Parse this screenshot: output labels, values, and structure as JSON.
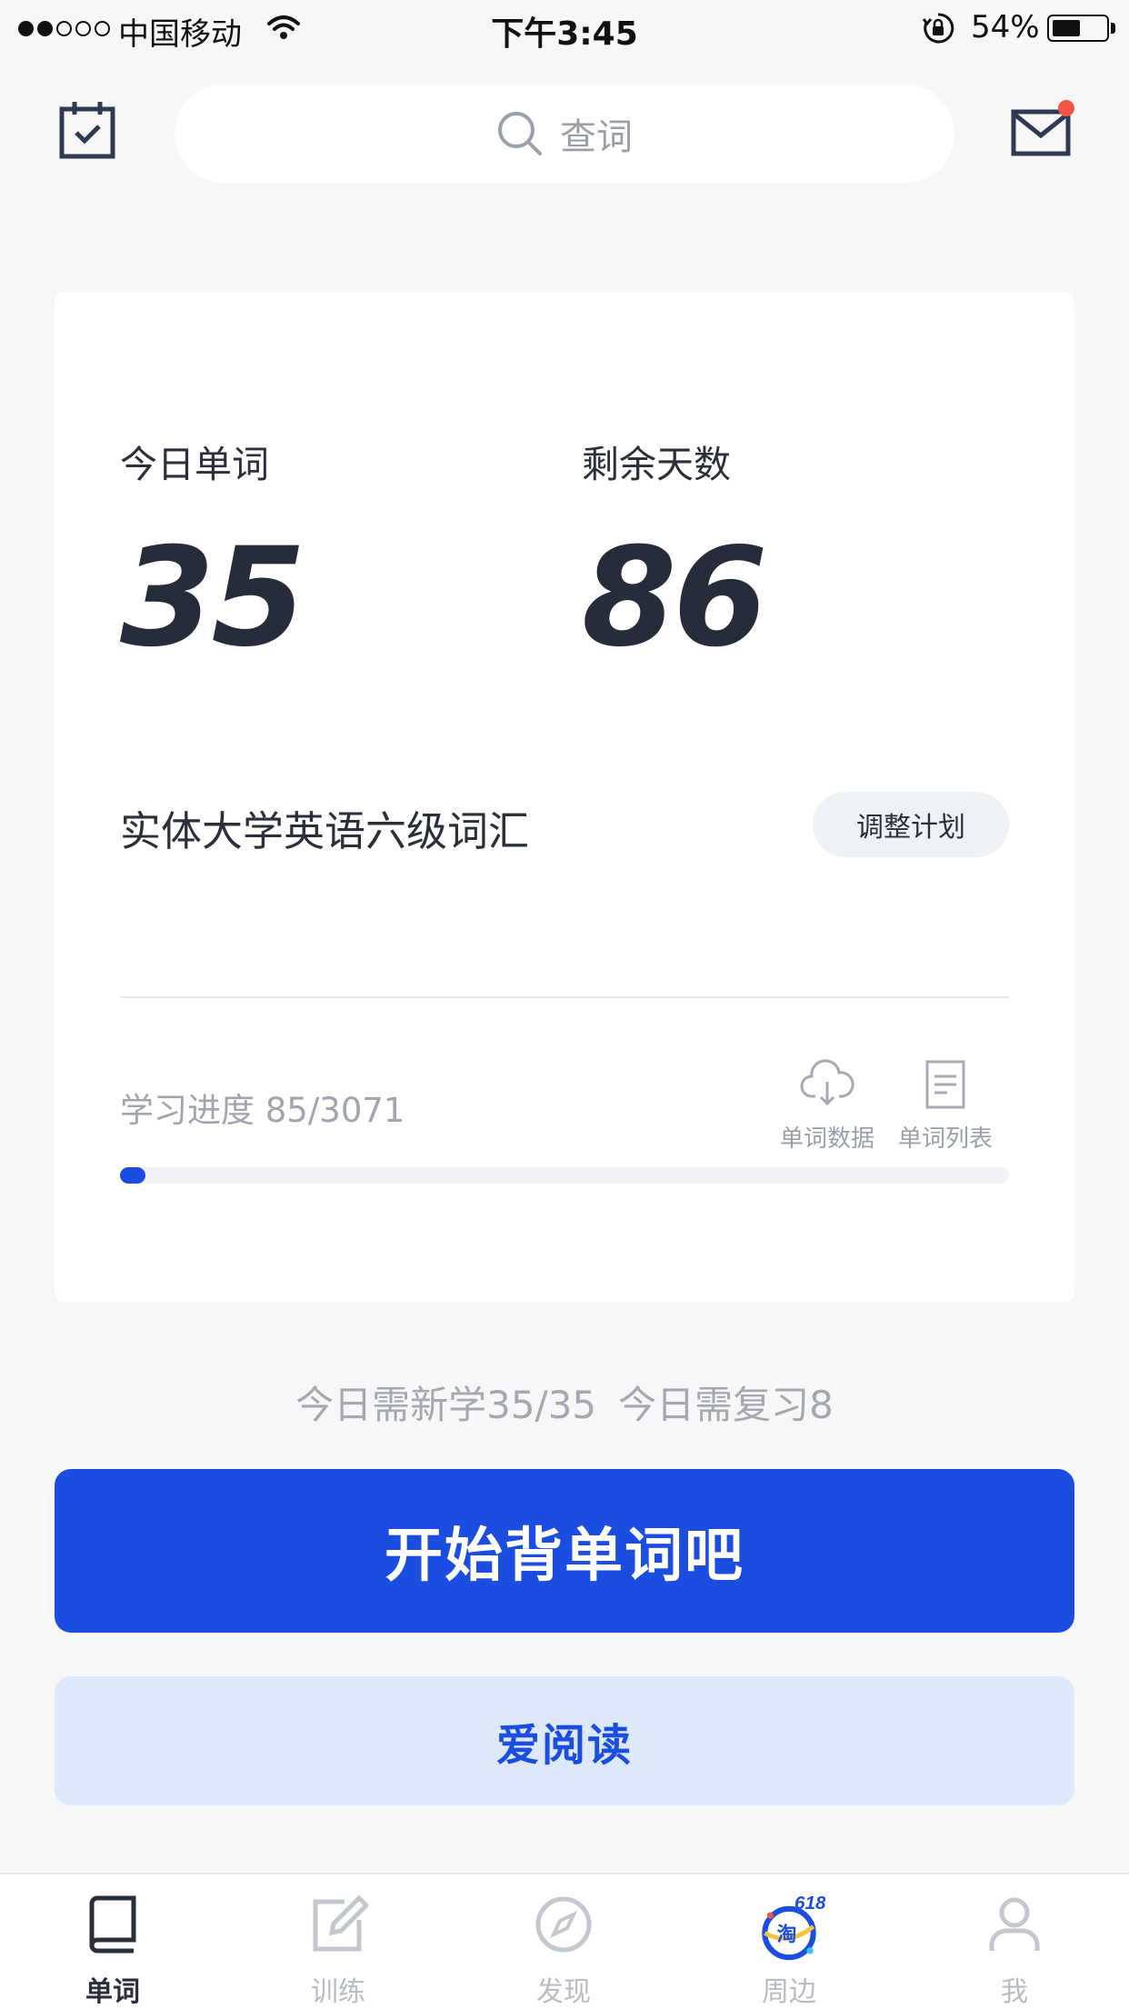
{
  "status_bar": {
    "carrier": "中国移动",
    "time": "下午3:45",
    "battery_pct": "54%",
    "battery_level": 0.54
  },
  "header": {
    "search_placeholder": "查词"
  },
  "plan": {
    "today_words_label": "今日单词",
    "today_words_value": "35",
    "days_left_label": "剩余天数",
    "days_left_value": "86",
    "book_name": "实体大学英语六级词汇",
    "adjust_label": "调整计划",
    "progress_label": "学习进度 85/3071",
    "progress_fraction": 0.028,
    "tools": {
      "word_data": "单词数据",
      "word_list": "单词列表"
    }
  },
  "today": {
    "new": "今日需新学35/35",
    "review": "今日需复习8"
  },
  "buttons": {
    "start": "开始背单词吧",
    "reading": "爱阅读"
  },
  "tabs": [
    {
      "label": "单词",
      "icon": "book-icon",
      "active": true
    },
    {
      "label": "训练",
      "icon": "edit-icon",
      "active": false
    },
    {
      "label": "发现",
      "icon": "compass-icon",
      "active": false
    },
    {
      "label": "周边",
      "icon": "taobao-618-icon",
      "active": false
    },
    {
      "label": "我",
      "icon": "person-icon",
      "active": false
    }
  ],
  "colors": {
    "primary": "#1a4de0",
    "reading_bg": "#dde9fb",
    "notif": "#f05545"
  }
}
